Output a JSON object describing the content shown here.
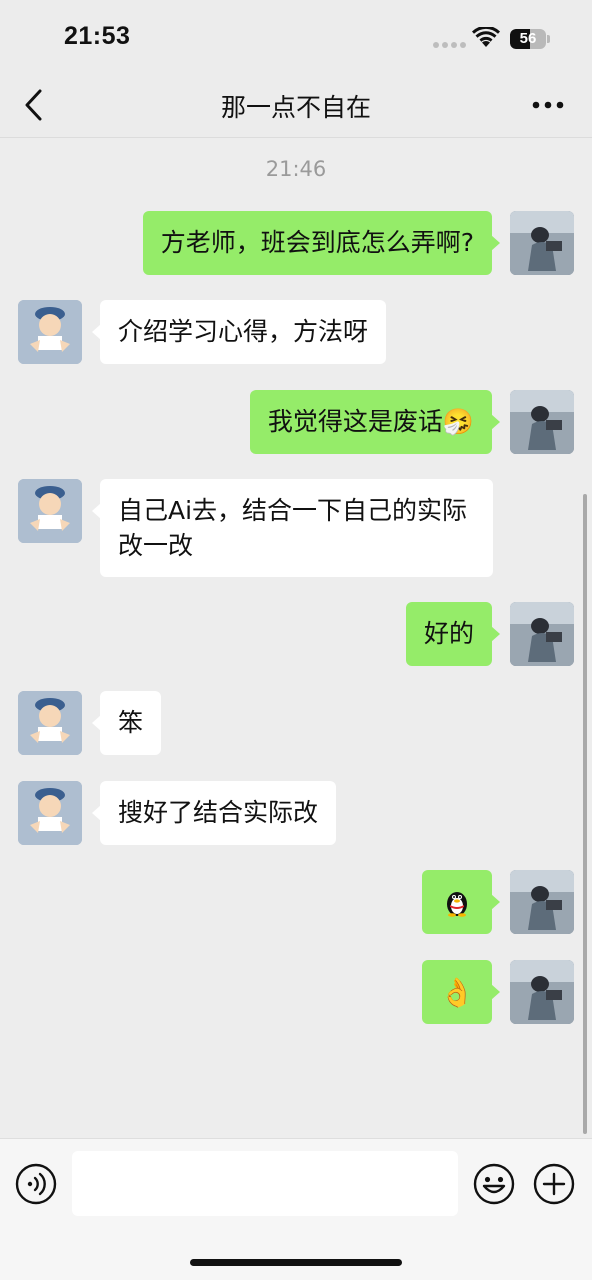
{
  "status_bar": {
    "time": "21:53",
    "battery": "56",
    "battery_level": 0.56
  },
  "header": {
    "title": "那一点不自在"
  },
  "chat": {
    "timestamp": "21:46",
    "messages": [
      {
        "from": "self",
        "text": "方老师，班会到底怎么弄啊?"
      },
      {
        "from": "other",
        "text": "介绍学习心得，方法呀"
      },
      {
        "from": "self",
        "text": "我觉得这是废话",
        "emoji": "🤧"
      },
      {
        "from": "other",
        "text": "自己Ai去，结合一下自己的实际改一改"
      },
      {
        "from": "self",
        "text": "好的"
      },
      {
        "from": "other",
        "text": "笨"
      },
      {
        "from": "other",
        "text": "搜好了结合实际改"
      },
      {
        "from": "self",
        "emoji": "🐧",
        "emoji_name": "penguin"
      },
      {
        "from": "self",
        "emoji": "👌",
        "emoji_name": "ok-hand"
      }
    ]
  },
  "input": {
    "placeholder": ""
  },
  "colors": {
    "self_bubble": "#95ec69",
    "other_bubble": "#ffffff",
    "background": "#ededed"
  }
}
